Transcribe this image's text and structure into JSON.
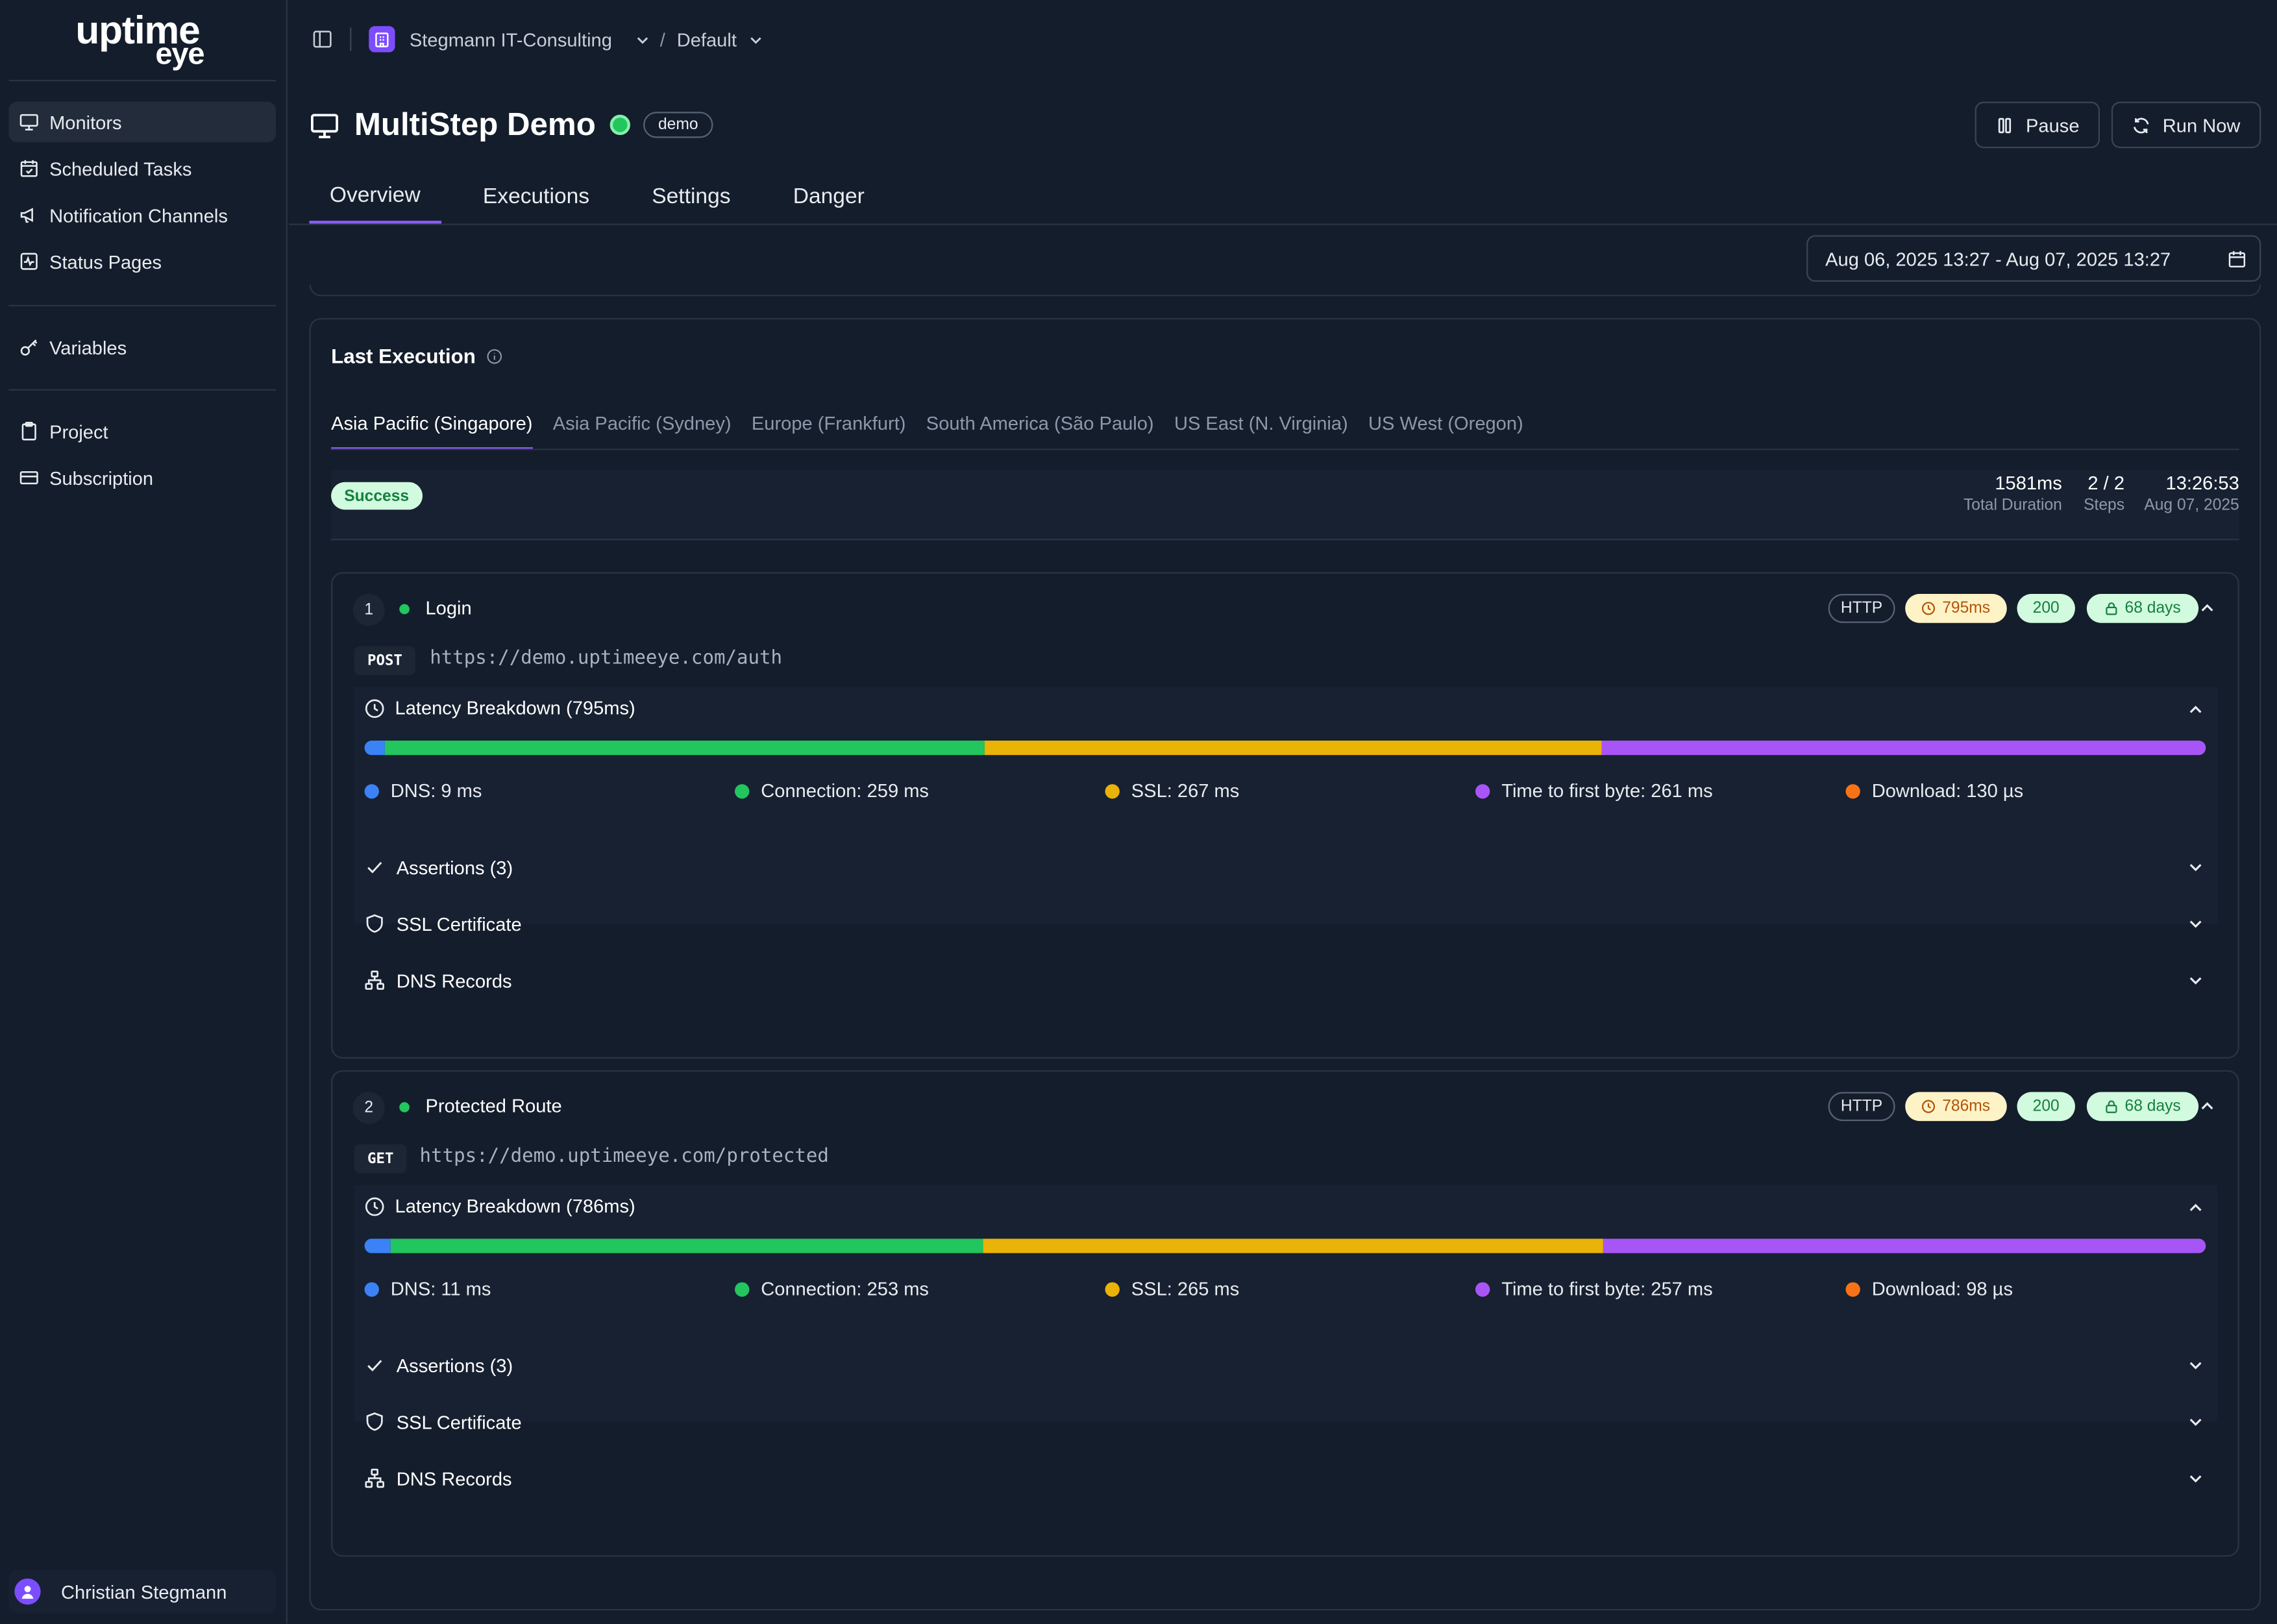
{
  "app": {
    "logo_line1": "uptime",
    "logo_line2": "eye"
  },
  "sidebar": {
    "items": [
      {
        "label": "Monitors",
        "active": true
      },
      {
        "label": "Scheduled Tasks"
      },
      {
        "label": "Notification Channels"
      },
      {
        "label": "Status Pages"
      },
      {
        "label": "Variables"
      },
      {
        "label": "Project"
      },
      {
        "label": "Subscription"
      }
    ],
    "user": "Christian Stegmann"
  },
  "topbar": {
    "org": "Stegmann IT-Consulting",
    "sep": "/",
    "env": "Default"
  },
  "monitor": {
    "title": "MultiStep Demo",
    "tag": "demo",
    "pause_label": "Pause",
    "run_label": "Run Now",
    "status_color": "#22c55e"
  },
  "tabs": [
    "Overview",
    "Executions",
    "Settings",
    "Danger"
  ],
  "date_range": "Aug 06, 2025 13:27 - Aug 07, 2025 13:27",
  "last_execution": {
    "title": "Last Execution",
    "regions": [
      "Asia Pacific (Singapore)",
      "Asia Pacific (Sydney)",
      "Europe (Frankfurt)",
      "South America (São Paulo)",
      "US East (N. Virginia)",
      "US West (Oregon)"
    ],
    "active_region": "Asia Pacific (Singapore)",
    "status": "Success",
    "stats": [
      {
        "value": "1581ms",
        "label": "Total Duration"
      },
      {
        "value": "2 / 2",
        "label": "Steps"
      },
      {
        "value": "13:26:53",
        "label": "Aug 07, 2025"
      }
    ]
  },
  "steps": [
    {
      "num": "1",
      "name": "Login",
      "protocol": "HTTP",
      "time": "795ms",
      "code": "200",
      "ssl": "68 days",
      "method": "POST",
      "url": "https://demo.uptimeeye.com/auth",
      "latency_title": "Latency Breakdown (795ms)",
      "segments": [
        {
          "label": "DNS: 9 ms",
          "value_ms": 9,
          "color": "#3b82f6"
        },
        {
          "label": "Connection: 259 ms",
          "value_ms": 259,
          "color": "#22c55e"
        },
        {
          "label": "SSL: 267 ms",
          "value_ms": 267,
          "color": "#eab308"
        },
        {
          "label": "Time to first byte: 261 ms",
          "value_ms": 261,
          "color": "#a855f7"
        },
        {
          "label": "Download: 130 µs",
          "value_ms": 0.13,
          "color": "#f97316"
        }
      ],
      "accordions": [
        "Assertions (3)",
        "SSL Certificate",
        "DNS Records"
      ]
    },
    {
      "num": "2",
      "name": "Protected Route",
      "protocol": "HTTP",
      "time": "786ms",
      "code": "200",
      "ssl": "68 days",
      "method": "GET",
      "url": "https://demo.uptimeeye.com/protected",
      "latency_title": "Latency Breakdown (786ms)",
      "segments": [
        {
          "label": "DNS: 11 ms",
          "value_ms": 11,
          "color": "#3b82f6"
        },
        {
          "label": "Connection: 253 ms",
          "value_ms": 253,
          "color": "#22c55e"
        },
        {
          "label": "SSL: 265 ms",
          "value_ms": 265,
          "color": "#eab308"
        },
        {
          "label": "Time to first byte: 257 ms",
          "value_ms": 257,
          "color": "#a855f7"
        },
        {
          "label": "Download: 98 µs",
          "value_ms": 0.098,
          "color": "#f97316"
        }
      ],
      "accordions": [
        "Assertions (3)",
        "SSL Certificate",
        "DNS Records"
      ]
    }
  ]
}
